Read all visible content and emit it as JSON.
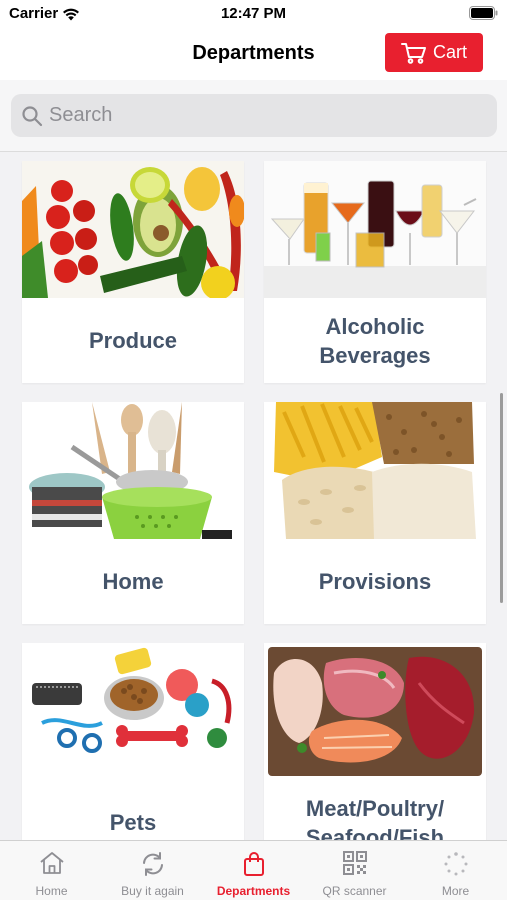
{
  "status_bar": {
    "carrier": "Carrier",
    "time": "12:47 PM"
  },
  "nav": {
    "title": "Departments",
    "cart_label": "Cart"
  },
  "search": {
    "placeholder": "Search"
  },
  "departments": [
    {
      "label": "Produce"
    },
    {
      "label": "Alcoholic\nBeverages"
    },
    {
      "label": "Home"
    },
    {
      "label": "Provisions"
    },
    {
      "label": "Pets"
    },
    {
      "label": "Meat/Poultry/\nSeafood/Fish"
    }
  ],
  "tabs": [
    {
      "label": "Home"
    },
    {
      "label": "Buy it again"
    },
    {
      "label": "Departments"
    },
    {
      "label": "QR scanner"
    },
    {
      "label": "More"
    }
  ],
  "colors": {
    "accent": "#e8202f",
    "label_text": "#44546a",
    "inactive_tab": "#8e8e93"
  }
}
